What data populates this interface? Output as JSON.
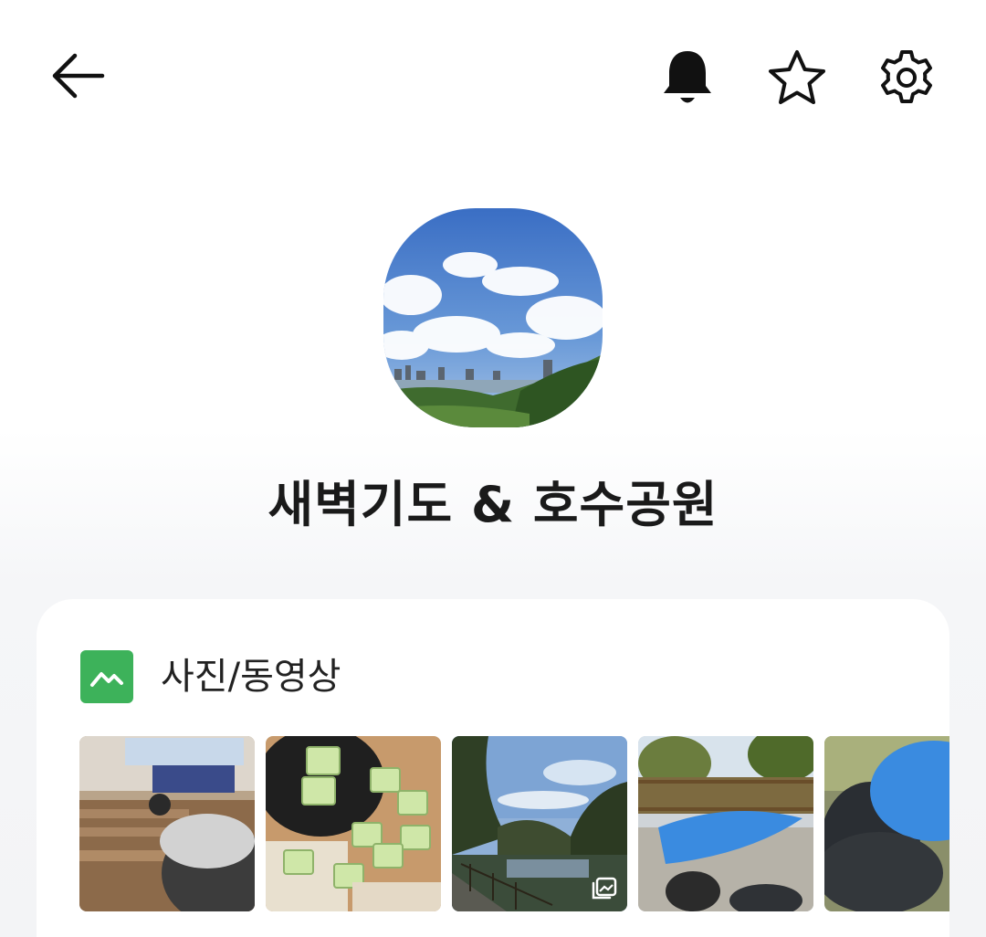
{
  "topbar": {
    "icons": [
      "arrow-left-icon",
      "bell-icon",
      "star-icon",
      "gear-icon"
    ]
  },
  "profile": {
    "title": "새벽기도 & 호수공원"
  },
  "media_section": {
    "label": "사진/동영상",
    "icon": "gallery-icon",
    "accent_color": "#3db25a",
    "thumbnails": [
      {
        "kind": "photo"
      },
      {
        "kind": "photo"
      },
      {
        "kind": "album",
        "badge_icon": "multi-photo-icon"
      },
      {
        "kind": "photo"
      },
      {
        "kind": "photo"
      }
    ]
  }
}
